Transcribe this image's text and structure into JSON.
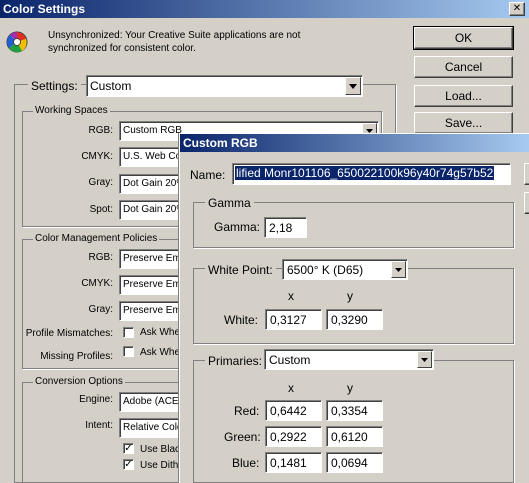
{
  "main_window": {
    "title": "Color Settings",
    "close_glyph": "✕",
    "warning_line1": "Unsynchronized: Your Creative Suite applications are not",
    "warning_line2": "synchronized for consistent color.",
    "settings_label": "Settings:",
    "settings_value": "Custom",
    "buttons": {
      "ok": "OK",
      "cancel": "Cancel",
      "load": "Load...",
      "save": "Save..."
    },
    "working_spaces": {
      "title": "Working Spaces",
      "rgb_label": "RGB:",
      "rgb_value": "Custom RGB",
      "cmyk_label": "CMYK:",
      "cmyk_value": "U.S. Web Co",
      "gray_label": "Gray:",
      "gray_value": "Dot Gain 20%",
      "spot_label": "Spot:",
      "spot_value": "Dot Gain 20%"
    },
    "policies": {
      "title": "Color Management Policies",
      "rgb_label": "RGB:",
      "rgb_value": "Preserve Em",
      "cmyk_label": "CMYK:",
      "cmyk_value": "Preserve Em",
      "gray_label": "Gray:",
      "gray_value": "Preserve Em",
      "mismatch_label": "Profile Mismatches:",
      "mismatch_check": "Ask Whe",
      "missing_label": "Missing Profiles:",
      "missing_check": "Ask Whe"
    },
    "conversion": {
      "title": "Conversion Options",
      "engine_label": "Engine:",
      "engine_value": "Adobe (ACE",
      "intent_label": "Intent:",
      "intent_value": "Relative Colo",
      "black_check": "Use Black",
      "dither_check": "Use Dithe"
    }
  },
  "custom_rgb": {
    "title": "Custom RGB",
    "name_label": "Name:",
    "name_value": "lified Monr101106_650022100k96y40r74g57b52",
    "gamma_group": "Gamma",
    "gamma_label": "Gamma:",
    "gamma_value": "2,18",
    "white_point_label": "White Point:",
    "white_point_value": "6500° K (D65)",
    "x_header": "x",
    "y_header": "y",
    "white_label": "White:",
    "white_x": "0,3127",
    "white_y": "0,3290",
    "primaries_label": "Primaries:",
    "primaries_value": "Custom",
    "red_label": "Red:",
    "red_x": "0,6442",
    "red_y": "0,3354",
    "green_label": "Green:",
    "green_x": "0,2922",
    "green_y": "0,6120",
    "blue_label": "Blue:",
    "blue_x": "0,1481",
    "blue_y": "0,0694"
  }
}
